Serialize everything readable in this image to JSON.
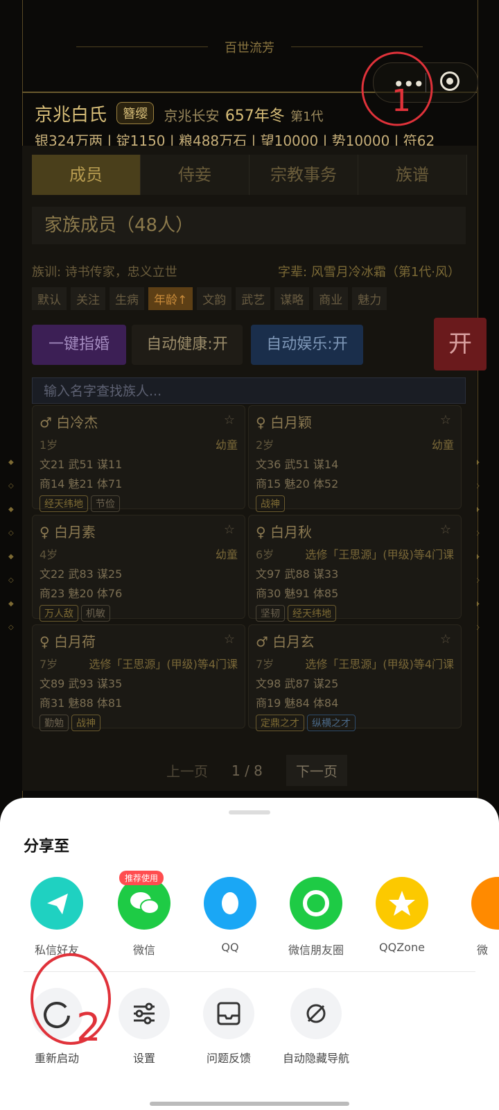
{
  "header": {
    "title": "百世流芳",
    "family_name": "京兆白氏",
    "badge": "簪缨",
    "location": "京兆长安",
    "year": "657年冬",
    "generation": "第1代",
    "stats": "银324万两 | 锭1150 | 粮488万石 | 望10000 | 势10000 | 符62"
  },
  "tabs": [
    "成员",
    "侍妾",
    "宗教事务",
    "族谱"
  ],
  "section_title": "家族成员（48人）",
  "motto": "族训: 诗书传家，忠义立世",
  "generation_names": "字辈: 风雪月冷冰霜（第1代·风）",
  "sort_options": [
    "默认",
    "关注",
    "生病",
    "年龄↑",
    "文韵",
    "武艺",
    "谋略",
    "商业",
    "魅力"
  ],
  "buttons": {
    "marry": "一键指婚",
    "auto_health": "自动健康:开",
    "auto_fun": "自动娱乐:开",
    "open": "开"
  },
  "search_placeholder": "输入名字查找族人...",
  "members": [
    {
      "name": "♂ 白冷杰",
      "age": "1岁",
      "status": "幼童",
      "l1": "文21 武51 谋11",
      "l2": "商14 魅21 体71",
      "tags": [
        "经天纬地",
        "节俭"
      ]
    },
    {
      "name": "♀ 白月颖",
      "age": "2岁",
      "status": "幼童",
      "l1": "文36 武51 谋14",
      "l2": "商15 魅20 体52",
      "tags": [
        "战神"
      ]
    },
    {
      "name": "♀ 白月素",
      "age": "4岁",
      "status": "幼童",
      "l1": "文22 武83 谋25",
      "l2": "商23 魅20 体76",
      "tags": [
        "万人敌",
        "机敏"
      ]
    },
    {
      "name": "♀ 白月秋",
      "age": "6岁",
      "status": "选修「王思源」(甲级)等4门课",
      "l1": "文97 武88 谋33",
      "l2": "商30 魅91 体85",
      "tags": [
        "坚韧",
        "经天纬地"
      ]
    },
    {
      "name": "♀ 白月荷",
      "age": "7岁",
      "status": "选修「王思源」(甲级)等4门课",
      "l1": "文89 武93 谋35",
      "l2": "商31 魅88 体81",
      "tags": [
        "勤勉",
        "战神"
      ]
    },
    {
      "name": "♂ 白月玄",
      "age": "7岁",
      "status": "选修「王思源」(甲级)等4门课",
      "l1": "文98 武87 谋25",
      "l2": "商19 魅84 体84",
      "tags": [
        "定鼎之才",
        "纵横之才"
      ]
    }
  ],
  "pager": {
    "prev": "上一页",
    "current": "1 / 8",
    "next": "下一页"
  },
  "share": {
    "title": "分享至",
    "recommend_badge": "推荐使用",
    "apps": [
      {
        "label": "私信好友",
        "icon": "paper-plane-icon",
        "color": "#1fd1c1"
      },
      {
        "label": "微信",
        "icon": "wechat-icon",
        "color": "#1ecb45"
      },
      {
        "label": "QQ",
        "icon": "qq-penguin-icon",
        "color": "#1aa7f5"
      },
      {
        "label": "微信朋友圈",
        "icon": "moments-shutter-icon",
        "color": "#1ecb45"
      },
      {
        "label": "QQZone",
        "icon": "qzone-star-icon",
        "color": "#fcc900"
      },
      {
        "label": "微",
        "icon": "weibo-icon",
        "color": "#ff8a00"
      }
    ],
    "actions": [
      {
        "label": "重新启动",
        "icon": "restart-icon"
      },
      {
        "label": "设置",
        "icon": "sliders-icon"
      },
      {
        "label": "问题反馈",
        "icon": "feedback-icon"
      },
      {
        "label": "自动隐藏导航",
        "icon": "hide-navigation-icon"
      }
    ]
  },
  "annotations": [
    "1",
    "2"
  ]
}
